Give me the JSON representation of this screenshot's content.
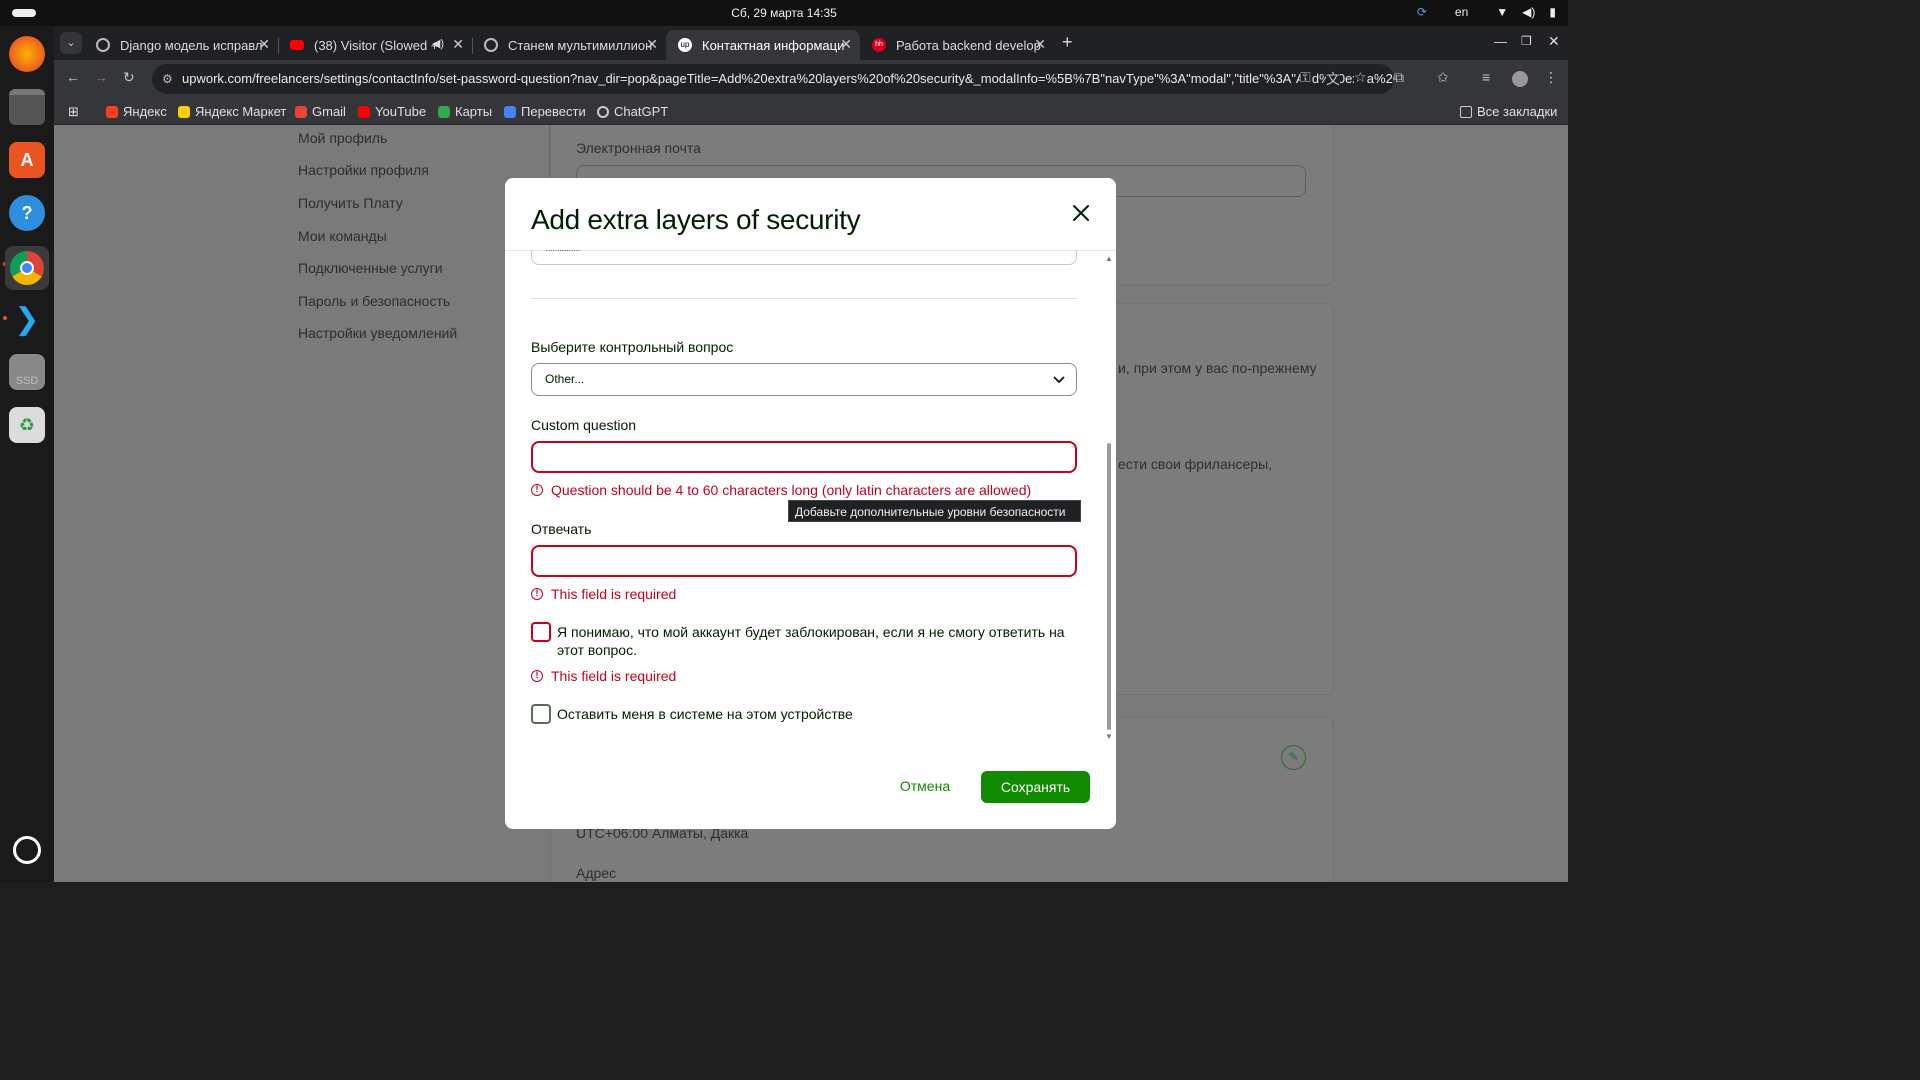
{
  "system": {
    "clock": "Сб, 29 марта  14:35",
    "lang": "en"
  },
  "browser": {
    "tabs": [
      {
        "title": "Django модель исправл",
        "color": "#bbbbbb"
      },
      {
        "title": "(38) Visitor (Slowed +",
        "color": "#ff0000"
      },
      {
        "title": "Станем мультимиллион",
        "color": "#bbbbbb"
      },
      {
        "title": "Контактная информаци",
        "color": "#ffffff"
      },
      {
        "title": "Работа backend develop",
        "color": "#d6001c"
      }
    ],
    "url": "upwork.com/freelancers/settings/contactInfo/set-password-question?nav_dir=pop&pageTitle=Add%20extra%20layers%20of%20security&_modalInfo=%5B%7B\"navType\"%3A\"modal\",\"title\"%3A\"Add%20extra%20...",
    "bookmarks": [
      {
        "label": "Яндекс",
        "color": "#fc3f1d"
      },
      {
        "label": "Яндекс Маркет",
        "color": "#ffcc00"
      },
      {
        "label": "Gmail",
        "color": "#ea4335"
      },
      {
        "label": "YouTube",
        "color": "#ff0000"
      },
      {
        "label": "Карты",
        "color": "#34a853"
      },
      {
        "label": "Перевести",
        "color": "#4285f4"
      },
      {
        "label": "ChatGPT",
        "color": "#cccccc"
      }
    ],
    "all_bookmarks": "Все закладки"
  },
  "background": {
    "nav": [
      "Мой профиль",
      "Настройки профиля",
      "Получить Плату",
      "Мои команды",
      "Подключенные услуги",
      "Пароль и безопасность",
      "Настройки уведомлений"
    ],
    "email_label": "Электронная почта",
    "text1": "и, при этом у вас по-прежнему",
    "text2": "ести свои фрилансеры,",
    "timezone": "UTC+06:00 Алматы, Дакка",
    "address_label": "Адрес"
  },
  "modal": {
    "title": "Add extra layers of security",
    "password_mask": "···············",
    "question_label": "Выберите контрольный вопрос",
    "question_value": "Other...",
    "custom_label": "Custom question",
    "custom_error": "Question should be 4 to 60 characters long (only latin characters are allowed)",
    "answer_label": "Отвечать",
    "answer_error": "This field is required",
    "ack_label": "Я понимаю, что мой аккаунт будет заблокирован, если я не смогу ответить на этот вопрос.",
    "ack_error": "This field is required",
    "remember_label": "Оставить меня в системе на этом устройстве",
    "cancel": "Отмена",
    "save": "Сохранять"
  },
  "tooltip": "Добавьте дополнительные уровни безопасности",
  "colors": {
    "accent": "#108a00",
    "error": "#c9001c"
  }
}
